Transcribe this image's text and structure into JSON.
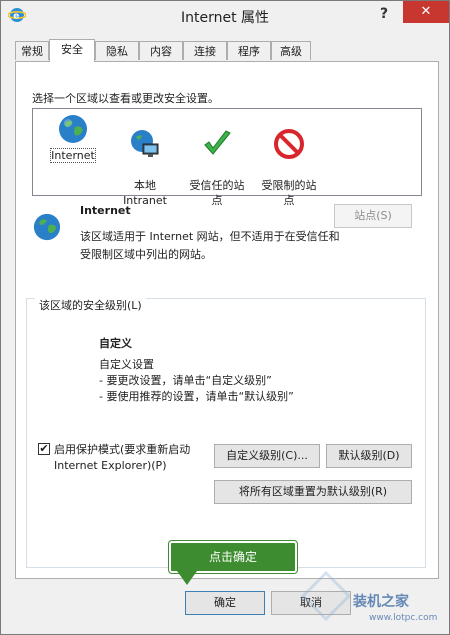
{
  "window": {
    "title": "Internet 属性",
    "help": "?",
    "close": "✕"
  },
  "tabs": [
    "常规",
    "安全",
    "隐私",
    "内容",
    "连接",
    "程序",
    "高级"
  ],
  "security": {
    "prompt": "选择一个区域以查看或更改安全设置。",
    "zones": [
      {
        "label": "Internet",
        "icon": "globe-icon"
      },
      {
        "label": "本地\nIntranet",
        "icon": "intranet-icon"
      },
      {
        "label": "受信任的站\n点",
        "icon": "checkmark-icon"
      },
      {
        "label": "受限制的站\n点",
        "icon": "restricted-icon"
      }
    ],
    "selected_zone": {
      "title": "Internet",
      "description": "该区域适用于 Internet 网站，但不适用于在受信任和受限制区域中列出的网站。",
      "sites_button": "站点(S)"
    },
    "level_group_label": "该区域的安全级别(L)",
    "level": {
      "title": "自定义",
      "lines": [
        "自定义设置",
        "- 要更改设置，请单击“自定义级别”",
        "- 要使用推荐的设置，请单击“默认级别”"
      ]
    },
    "protected_mode": {
      "checked": true,
      "label": "启用保护模式(要求重新启动 Internet Explorer)(P)"
    },
    "custom_level_button": "自定义级别(C)...",
    "default_level_button": "默认级别(D)",
    "reset_all_button": "将所有区域重置为默认级别(R)"
  },
  "footer": {
    "ok": "确定",
    "cancel": "取消"
  },
  "annotation": {
    "text": "点击确定",
    "color": "#3d8c2f"
  },
  "watermark": {
    "text": "装机之家",
    "url": "www.lotpc.com"
  }
}
